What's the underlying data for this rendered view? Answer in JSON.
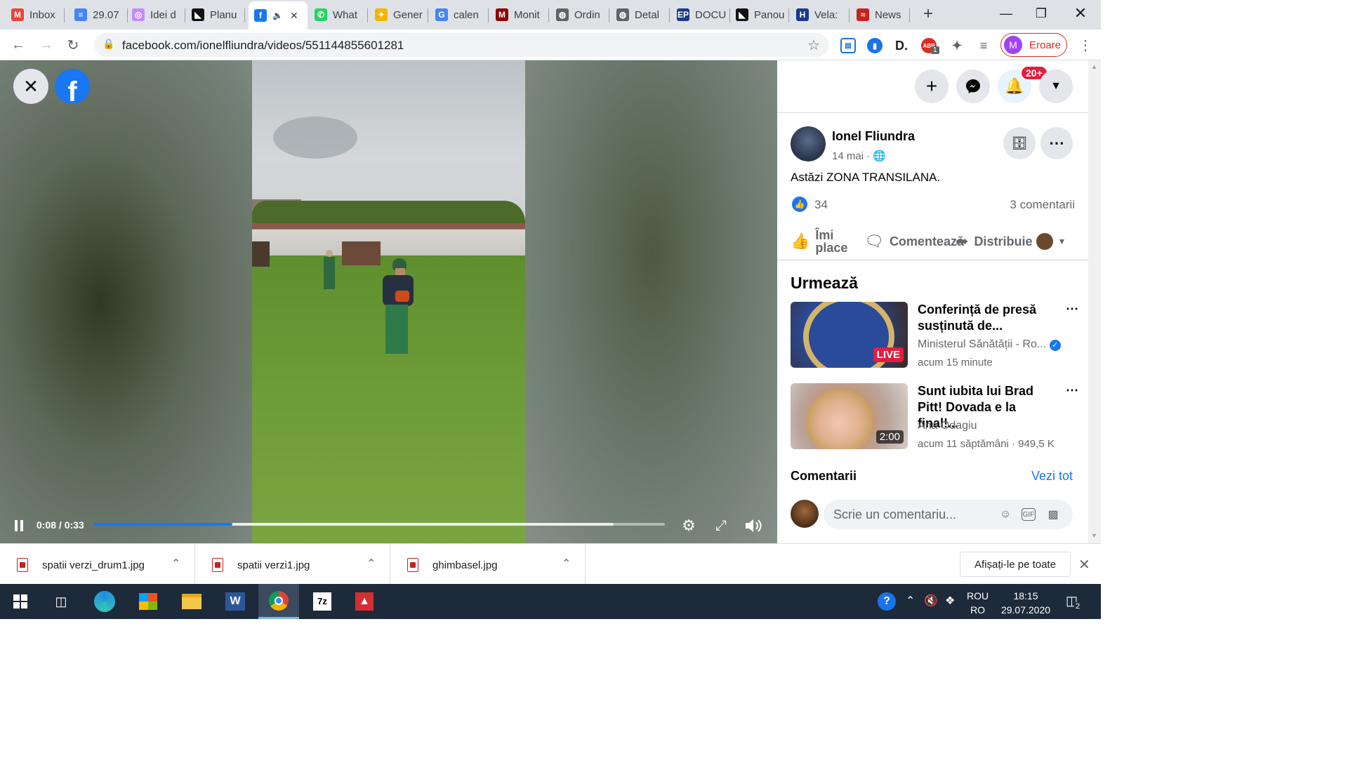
{
  "tabs": [
    {
      "label": "Inbox",
      "icon": "gmail-icon",
      "color": "#ea4335",
      "glyph": "M"
    },
    {
      "label": "29.07",
      "icon": "docs-icon",
      "color": "#4285f4",
      "glyph": "≡"
    },
    {
      "label": "Idei d",
      "icon": "site-icon",
      "color": "#c58af9",
      "glyph": "◎"
    },
    {
      "label": "Planu",
      "icon": "site-icon",
      "color": "#111111",
      "glyph": "◣"
    },
    {
      "label": "",
      "icon": "facebook-icon",
      "color": "#1877f2",
      "glyph": "f"
    },
    {
      "label": "What",
      "icon": "whatsapp-icon",
      "color": "#25d366",
      "glyph": "✆"
    },
    {
      "label": "Gener",
      "icon": "site-icon",
      "color": "#f4b400",
      "glyph": "✦"
    },
    {
      "label": "calen",
      "icon": "google-icon",
      "color": "#4285f4",
      "glyph": "G"
    },
    {
      "label": "Monit",
      "icon": "site-icon",
      "color": "#8b0000",
      "glyph": "M"
    },
    {
      "label": "Ordin",
      "icon": "globe-icon",
      "color": "#5f6368",
      "glyph": "◍"
    },
    {
      "label": "Detal",
      "icon": "globe-icon",
      "color": "#5f6368",
      "glyph": "◍"
    },
    {
      "label": "DOCU",
      "icon": "site-icon",
      "color": "#1a3b8b",
      "glyph": "EP"
    },
    {
      "label": "Panou",
      "icon": "site-icon",
      "color": "#111111",
      "glyph": "◣"
    },
    {
      "label": "Vela:",
      "icon": "site-icon",
      "color": "#1a3b8b",
      "glyph": "H"
    },
    {
      "label": "News",
      "icon": "site-icon",
      "color": "#c5221f",
      "glyph": "≈"
    }
  ],
  "toolbar": {
    "url": "facebook.com/ionelfliundra/videos/551144855601281",
    "profile_initial": "M",
    "profile_label": "Eroare",
    "ext_badge": "1"
  },
  "video": {
    "time": "0:08 / 0:33",
    "progress_fraction": 0.244,
    "buffered_fraction": 0.91
  },
  "header": {
    "notifications_badge": "20+"
  },
  "post": {
    "author": "Ionel Fliundra",
    "date": "14 mai ·",
    "text": "Astăzi ZONA TRANSILANA.",
    "likes": "34",
    "comments": "3 comentarii",
    "like_label_1": "Îmi",
    "like_label_2": "place",
    "comment_label": "Comentează",
    "share_label": "Distribuie"
  },
  "up_next": {
    "heading": "Urmează",
    "videos": [
      {
        "title": "Conferință de presă susținută de...",
        "channel": "Ministerul Sănătății - Ro...",
        "meta": "acum 15 minute",
        "badge": "LIVE"
      },
      {
        "title": "Sunt iubita lui Brad Pitt! Dovada e la final!...",
        "channel": "Ana Odagiu",
        "meta": "acum 11 săptămâni · 949,5 K",
        "badge": "2:00"
      }
    ]
  },
  "comments": {
    "heading": "Comentarii",
    "see_all": "Vezi tot",
    "placeholder": "Scrie un comentariu..."
  },
  "downloads": {
    "files": [
      "spatii verzi_drum1.jpg",
      "spatii verzi1.jpg",
      "ghimbasel.jpg"
    ],
    "show_all": "Afișați-le pe toate"
  },
  "taskbar": {
    "lang_top": "ROU",
    "lang_bottom": "RO",
    "time": "18:15",
    "date": "29.07.2020",
    "notif_count": "2"
  }
}
